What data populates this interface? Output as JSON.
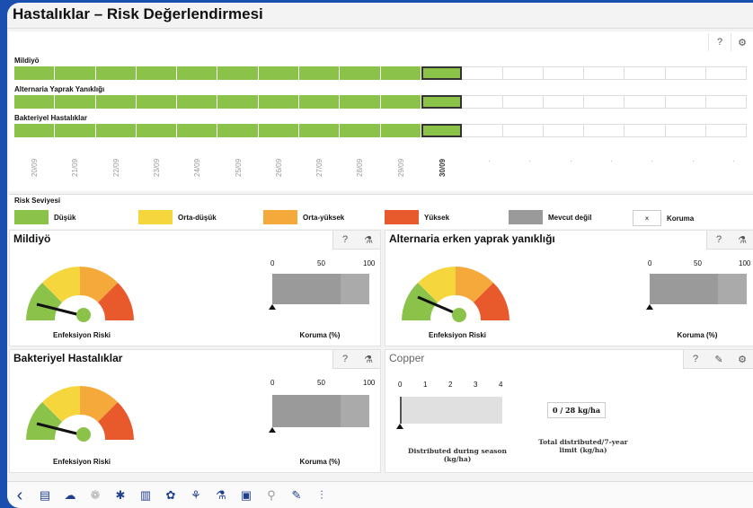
{
  "header": {
    "title": "Hastalıklar – Risk Değerlendirmesi"
  },
  "timeline": {
    "rows": [
      {
        "label": "Mildiyö"
      },
      {
        "label": "Alternaria Yaprak Yanıklığı"
      },
      {
        "label": "Bakteriyel Hastalıklar"
      }
    ],
    "dates": [
      "20/09",
      "21/09",
      "22/09",
      "23/09",
      "24/09",
      "25/09",
      "26/09",
      "27/09",
      "28/09",
      "29/09",
      "30/09"
    ],
    "current_date": "30/09",
    "filled_cells": 10,
    "future_cells": 7
  },
  "legend": {
    "title": "Risk Seviyesi",
    "items": [
      {
        "label": "Düşük",
        "color": "#8bc34a"
      },
      {
        "label": "Orta-düşük",
        "color": "#f5d63d"
      },
      {
        "label": "Orta-yüksek",
        "color": "#f5a93a"
      },
      {
        "label": "Yüksek",
        "color": "#e85a2c"
      },
      {
        "label": "Mevcut değil",
        "color": "#9a9a9a"
      },
      {
        "label": "Koruma",
        "icon": "×"
      }
    ]
  },
  "panels": {
    "mildiyo": {
      "title": "Mildiyö",
      "gauge_label": "Enfeksiyon Riski",
      "protection_label": "Koruma (%)",
      "ticks": [
        "0",
        "50",
        "100"
      ]
    },
    "alternaria": {
      "title": "Alternaria erken yaprak yanıklığı",
      "gauge_label": "Enfeksiyon Riski",
      "protection_label": "Koruma (%)",
      "ticks": [
        "0",
        "50",
        "100"
      ]
    },
    "bakteriyel": {
      "title": "Bakteriyel Hastalıklar",
      "gauge_label": "Enfeksiyon Riski",
      "protection_label": "Koruma (%)",
      "ticks": [
        "0",
        "50",
        "100"
      ]
    },
    "copper": {
      "title": "Copper",
      "ticks": [
        "0",
        "1",
        "2",
        "3",
        "4"
      ],
      "value": "0 / 28 kg/ha",
      "distributed_label": "Distributed during season (kg/ha)",
      "total_label": "Total distributed/7-year limit (kg/ha)"
    }
  },
  "icons": {
    "help": "help-icon",
    "settings": "gear-icon",
    "print": "flask-icon",
    "edit": "pencil-icon"
  }
}
